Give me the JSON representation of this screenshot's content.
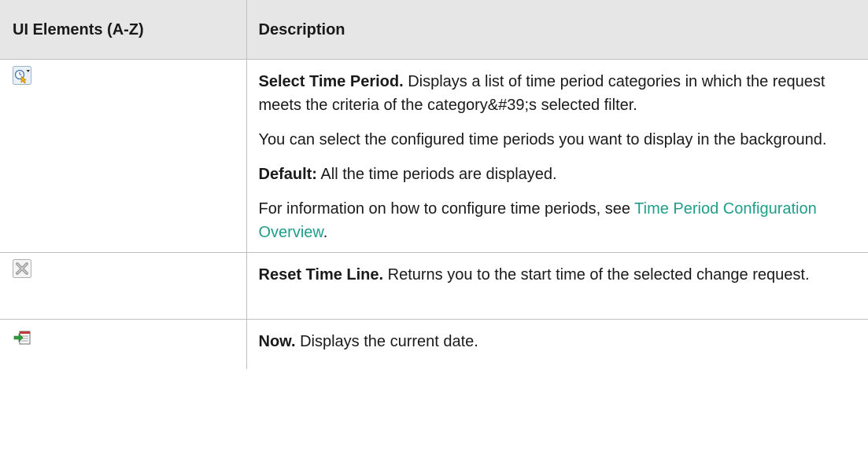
{
  "table": {
    "headers": {
      "col1": "UI Elements (A-Z)",
      "col2": "Description"
    },
    "rows": [
      {
        "icon": "select-time-period-icon",
        "lead": "Select Time Period.",
        "text": " Displays a list of time period categories in which the request meets the criteria of the category&#39;s selected filter.",
        "para2": "You can select the configured time periods you want to display in the background.",
        "default_label": "Default:",
        "default_text": " All the time periods are displayed.",
        "info_prefix": "For information on how to configure time periods, see ",
        "info_link": "Time Period Configuration Overview",
        "info_suffix": "."
      },
      {
        "icon": "reset-time-line-icon",
        "lead": "Reset Time Line.",
        "text": " Returns you to the start time of the selected change request."
      },
      {
        "icon": "now-icon",
        "lead": "Now.",
        "text": " Displays the current date."
      }
    ]
  },
  "colors": {
    "header_bg": "#e6e6e6",
    "link": "#1f9e8a",
    "border": "#bfbfbf"
  }
}
